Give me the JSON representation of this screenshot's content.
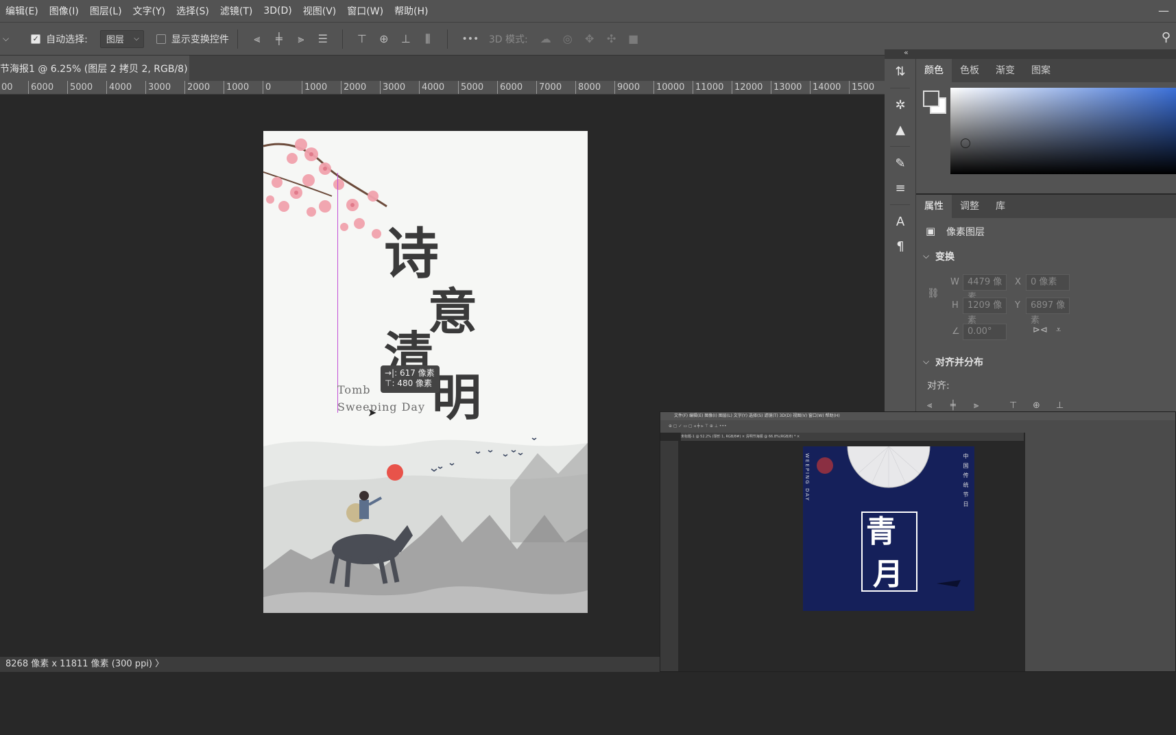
{
  "menu": [
    "编辑(E)",
    "图像(I)",
    "图层(L)",
    "文字(Y)",
    "选择(S)",
    "滤镜(T)",
    "3D(D)",
    "视图(V)",
    "窗口(W)",
    "帮助(H)"
  ],
  "options": {
    "auto_select_label": "自动选择:",
    "auto_select_value": "图层",
    "show_transform_label": "显示变换控件",
    "more": "•••",
    "mode_3d_label": "3D 模式:"
  },
  "document_tab": {
    "title": "节海报1 @ 6.25% (图层 2 拷贝 2, RGB/8) *",
    "close": "×"
  },
  "ruler_ticks": [
    "00",
    "6000",
    "5000",
    "4000",
    "3000",
    "2000",
    "1000",
    "0",
    "1000",
    "2000",
    "3000",
    "4000",
    "5000",
    "6000",
    "7000",
    "8000",
    "9000",
    "10000",
    "11000",
    "12000",
    "13000",
    "14000",
    "1500"
  ],
  "canvas": {
    "poster_text": {
      "char1": "诗",
      "char2": "意",
      "char3": "清",
      "char4": "明",
      "en_line1": "Tomb",
      "en_line2": "Sweeping Day"
    },
    "tooltip": {
      "line1": "→|: 617 像素",
      "line2": "⊤: 480 像素"
    }
  },
  "status": {
    "text": "8268 像素 x 11811 像素 (300 ppi)",
    "arrow": "〉"
  },
  "color_panel": {
    "tabs": [
      "颜色",
      "色板",
      "渐变",
      "图案"
    ],
    "active": "颜色"
  },
  "properties_panel": {
    "tabs": [
      "属性",
      "调整",
      "库"
    ],
    "active": "属性",
    "layer_type": "像素图层",
    "transform_section": "变换",
    "w_label": "W",
    "w_value": "4479 像素",
    "x_label": "X",
    "x_value": "0 像素",
    "h_label": "H",
    "h_value": "1209 像素",
    "y_label": "Y",
    "y_value": "6897 像素",
    "angle_value": "0.00°",
    "align_section": "对齐并分布",
    "align_label": "对齐:"
  },
  "mini_window": {
    "menu": "文件(F) 编辑(E) 图像(I) 图层(L) 文字(Y) 选择(S) 滤镜(T) 3D(D) 视图(V) 窗口(W) 帮助(H)",
    "tabs": "未标题-1 @ 52.2% (球形 1, RGB/8#) ×    清明节海报 @ 66.8%(RGB/8) * ×",
    "poster_side_text": "WEEPING DAY",
    "poster_vertical": "中国传统节日",
    "poster_char1": "青",
    "poster_char2": "月"
  },
  "colors": {
    "accent_guide": "#c24fd6",
    "sun": "#e8534a",
    "mini_poster_bg": "#15205a"
  }
}
